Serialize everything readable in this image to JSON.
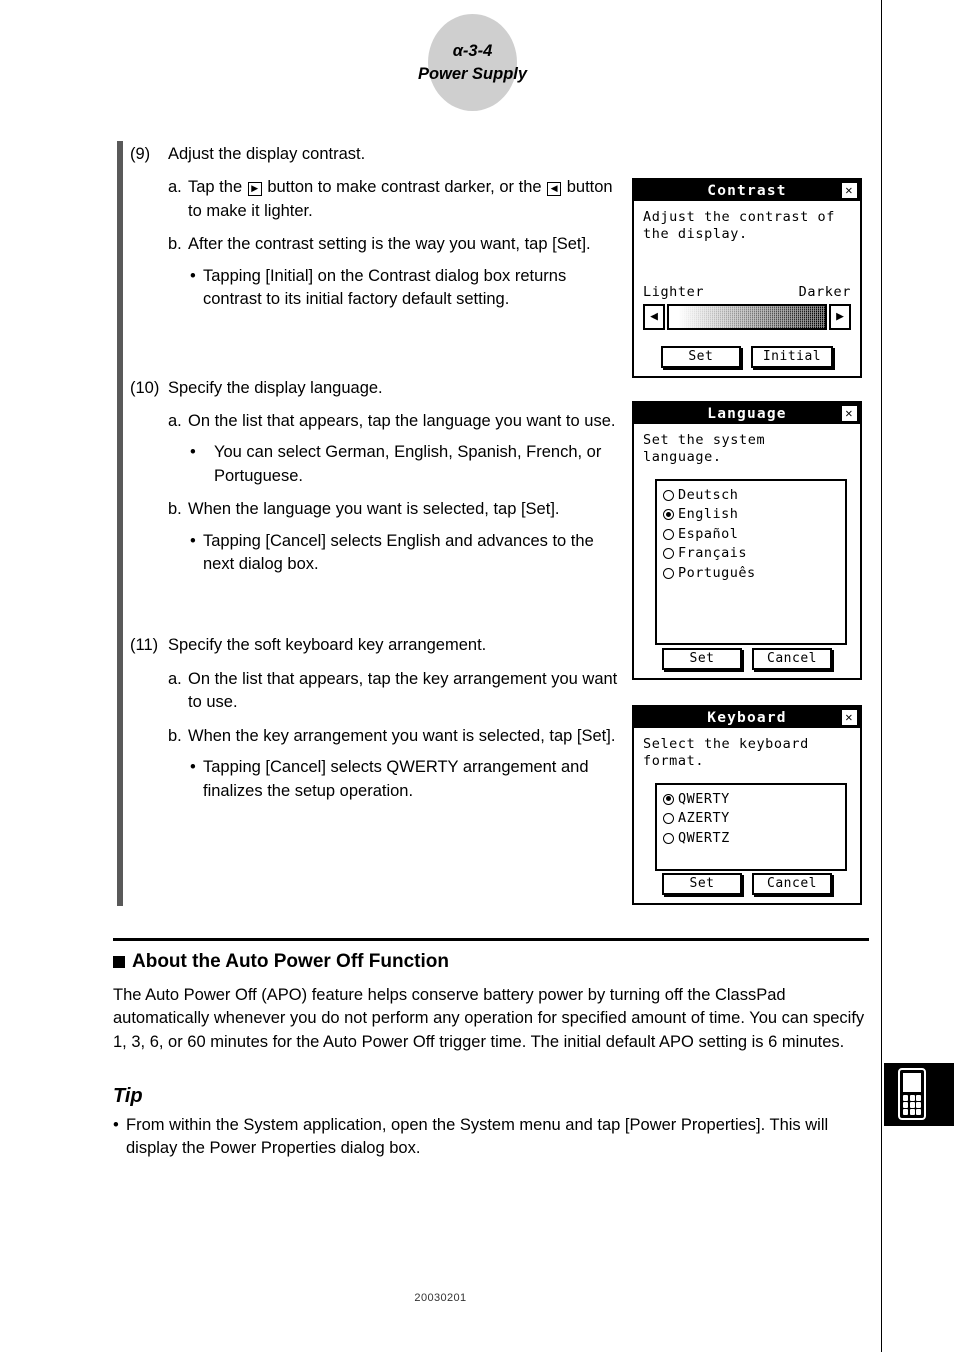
{
  "header": {
    "section_code": "α-3-4",
    "section_title": "Power Supply"
  },
  "steps": [
    {
      "number": "(9)",
      "title": "Adjust the display contrast.",
      "items": [
        {
          "marker": "a.",
          "text_before": "Tap the",
          "glyph1": "▶",
          "text_middle": "button to make contrast darker, or the",
          "glyph2": "◀",
          "text_after": "button to make it lighter."
        },
        {
          "marker": "b.",
          "text": "After the contrast setting is the way you want, tap [Set]."
        }
      ],
      "notes": [
        {
          "marker": "•",
          "text": "Tapping [Initial] on the Contrast dialog box returns contrast to its initial factory default setting."
        }
      ]
    },
    {
      "number": "(10)",
      "title": "Specify the display language.",
      "items": [
        {
          "marker": "a.",
          "text": "On the list that appears, tap the language you want to use."
        },
        {
          "marker": "b.",
          "text": "When the language you want is selected, tap [Set]."
        }
      ],
      "notes": [
        {
          "marker": "•",
          "text": "You can select German, English, Spanish, French, or Portuguese."
        },
        {
          "marker": "•",
          "text": "Tapping [Cancel] selects English and advances to the next dialog box."
        }
      ]
    },
    {
      "number": "(11)",
      "title": "Specify the soft keyboard key arrangement.",
      "items": [
        {
          "marker": "a.",
          "text": "On the list that appears, tap the key arrangement you want to use."
        },
        {
          "marker": "b.",
          "text": "When the key arrangement you want is selected, tap [Set]."
        }
      ],
      "notes": [
        {
          "marker": "•",
          "text": "Tapping [Cancel] selects QWERTY arrangement and finalizes the setup operation."
        }
      ]
    }
  ],
  "dialogs": {
    "contrast": {
      "title": "Contrast",
      "close_label": "✕",
      "description": "Adjust the contrast of\nthe display.",
      "label_left": "Lighter",
      "label_right": "Darker",
      "arrow_left": "◀",
      "arrow_right": "▶",
      "buttons": [
        {
          "label": "Set"
        },
        {
          "label": "Initial"
        }
      ]
    },
    "language": {
      "title": "Language",
      "close_label": "✕",
      "description": "Set the system\nlanguage.",
      "options": [
        {
          "label": "Deutsch",
          "selected": false
        },
        {
          "label": "English",
          "selected": true
        },
        {
          "label": "Español",
          "selected": false
        },
        {
          "label": "Français",
          "selected": false
        },
        {
          "label": "Português",
          "selected": false
        }
      ],
      "buttons": [
        {
          "label": "Set"
        },
        {
          "label": "Cancel"
        }
      ]
    },
    "keyboard": {
      "title": "Keyboard",
      "close_label": "✕",
      "description": "Select the keyboard\nformat.",
      "options": [
        {
          "label": "QWERTY",
          "selected": true
        },
        {
          "label": "AZERTY",
          "selected": false
        },
        {
          "label": "QWERTZ",
          "selected": false
        }
      ],
      "buttons": [
        {
          "label": "Set"
        },
        {
          "label": "Cancel"
        }
      ]
    }
  },
  "apo": {
    "heading": "About the Auto Power Off Function",
    "body": "The Auto Power Off (APO) feature helps conserve battery power by turning off the ClassPad automatically whenever you do not perform any operation for specified amount of time. You can specify 1, 3, 6, or 60 minutes for the Auto Power Off trigger time. The initial default APO setting is 6 minutes."
  },
  "tip": {
    "heading": "Tip",
    "marker": "•",
    "text": "From within the System application, open the System menu and tap [Power Properties]. This will display the Power Properties dialog box."
  },
  "footer": {
    "doc_id": "20030201"
  },
  "colors": {
    "badge_gray": "#cfcfcf",
    "rule_gray": "#595959",
    "ink": "#000000"
  }
}
